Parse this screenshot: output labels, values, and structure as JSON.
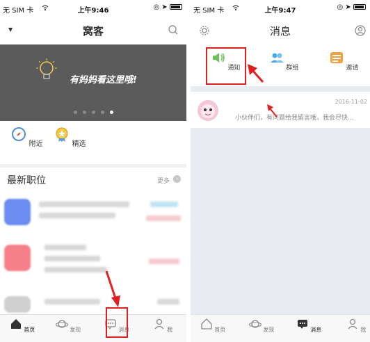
{
  "left": {
    "status": {
      "carrier": "无 SIM 卡 ",
      "time": "上午9:46"
    },
    "app_title": "窝客",
    "banner": {
      "text": "有妈妈看这里哦!"
    },
    "quick_items": [
      {
        "label": "附近",
        "icon": "compass-icon"
      },
      {
        "label": "精选",
        "icon": "medal-icon"
      }
    ],
    "section": {
      "title": "最新职位",
      "more": "更多"
    },
    "tabs": [
      {
        "label": "首页",
        "icon": "home-icon"
      },
      {
        "label": "发现",
        "icon": "planet-icon"
      },
      {
        "label": "消息",
        "icon": "message-icon"
      },
      {
        "label": "我",
        "icon": "person-icon"
      }
    ]
  },
  "right": {
    "status": {
      "carrier": "无 SIM 卡 ",
      "time": "上午9:47"
    },
    "title": "消息",
    "msg_tabs": [
      {
        "label": "通知",
        "icon": "speaker-icon",
        "color": "#6cc05c"
      },
      {
        "label": "群组",
        "icon": "group-icon",
        "color": "#4da9e6"
      },
      {
        "label": "邀请",
        "icon": "invite-icon",
        "color": "#f0a040"
      }
    ],
    "conversation": {
      "date": "2016-11-02",
      "preview": "小伙伴们，有问题给我留言哦，我会尽快..."
    },
    "tabs": [
      {
        "label": "首页",
        "icon": "home-icon"
      },
      {
        "label": "发现",
        "icon": "planet-icon"
      },
      {
        "label": "消息",
        "icon": "message-icon"
      },
      {
        "label": "我",
        "icon": "person-icon"
      }
    ]
  },
  "colors": {
    "highlight": "#e02020",
    "banner_bg": "#5b5b5b"
  }
}
